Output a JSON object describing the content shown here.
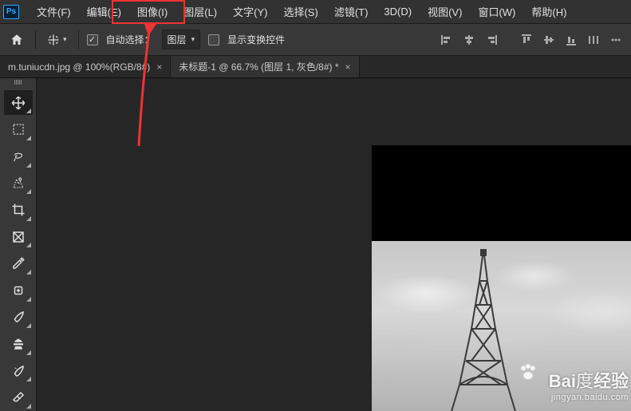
{
  "menubar": {
    "items": [
      {
        "label": "文件(F)"
      },
      {
        "label": "编辑(E)"
      },
      {
        "label": "图像(I)"
      },
      {
        "label": "图层(L)"
      },
      {
        "label": "文字(Y)"
      },
      {
        "label": "选择(S)"
      },
      {
        "label": "滤镜(T)"
      },
      {
        "label": "3D(D)"
      },
      {
        "label": "视图(V)"
      },
      {
        "label": "窗口(W)"
      },
      {
        "label": "帮助(H)"
      }
    ]
  },
  "optionsbar": {
    "auto_select_label": "自动选择：",
    "auto_select_checked": true,
    "target_dropdown": "图层",
    "show_transform_label": "显示变换控件",
    "show_transform_checked": false
  },
  "tabs": [
    {
      "label": "m.tuniucdn.jpg @ 100%(RGB/8#)",
      "active": false
    },
    {
      "label": "未标题-1 @ 66.7% (图层 1, 灰色/8#) *",
      "active": true
    }
  ],
  "tools": [
    {
      "name": "move-tool",
      "active": true
    },
    {
      "name": "marquee-tool"
    },
    {
      "name": "lasso-tool"
    },
    {
      "name": "quick-select-tool"
    },
    {
      "name": "crop-tool"
    },
    {
      "name": "frame-tool"
    },
    {
      "name": "eyedropper-tool"
    },
    {
      "name": "healing-brush-tool"
    },
    {
      "name": "brush-tool"
    },
    {
      "name": "clone-stamp-tool"
    },
    {
      "name": "history-brush-tool"
    },
    {
      "name": "eraser-tool"
    }
  ],
  "watermark": {
    "brand": "Bai",
    "brand2": "经验",
    "sub": "jingyan.baidu.com"
  }
}
